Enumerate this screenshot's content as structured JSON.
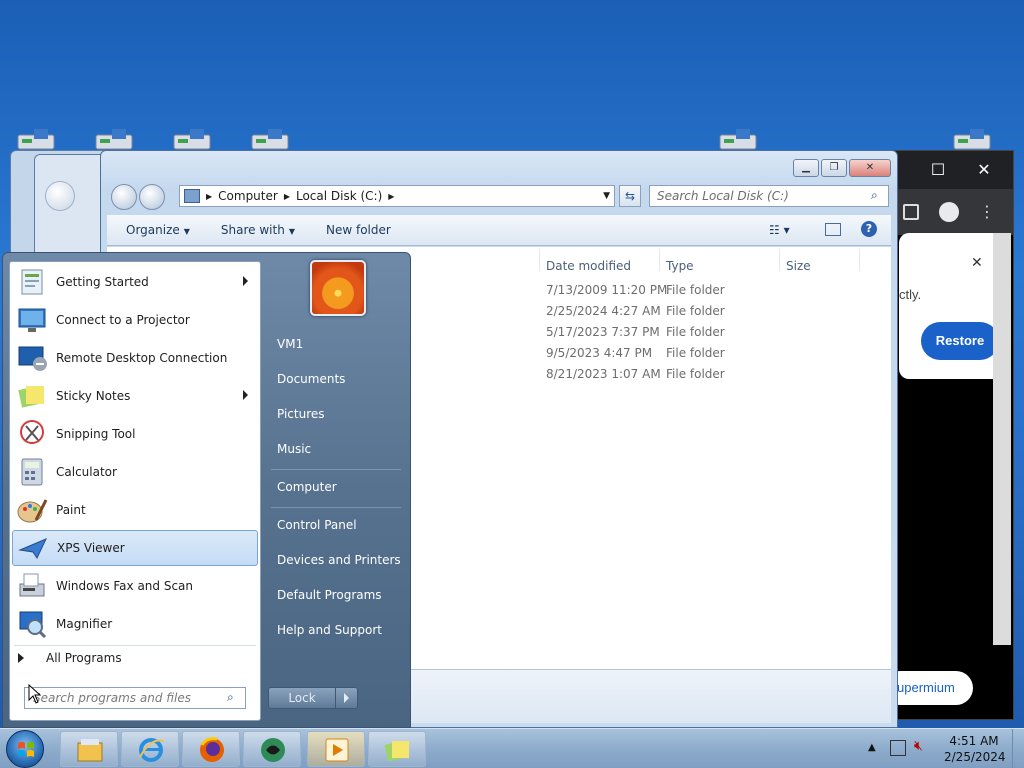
{
  "explorer": {
    "address": {
      "crumbs": [
        "Computer",
        "Local Disk (C:)"
      ]
    },
    "search_placeholder": "Search Local Disk (C:)",
    "toolbar": {
      "organize": "Organize",
      "share_with": "Share with",
      "new_folder": "New folder"
    },
    "columns": {
      "date_modified": "Date modified",
      "type": "Type",
      "size": "Size"
    },
    "rows": [
      {
        "date": "7/13/2009 11:20 PM",
        "type": "File folder"
      },
      {
        "date": "2/25/2024 4:27 AM",
        "type": "File folder"
      },
      {
        "date": "5/17/2023 7:37 PM",
        "type": "File folder"
      },
      {
        "date": "9/5/2023 4:47 PM",
        "type": "File folder"
      },
      {
        "date": "8/21/2023 1:07 AM",
        "type": "File folder"
      }
    ]
  },
  "chrome": {
    "popup_text": "ctly.",
    "restore_label": "Restore",
    "bottom_pill": "upermium"
  },
  "start_menu": {
    "programs": [
      {
        "label": "Getting Started",
        "icon": "getting-started-icon",
        "has_submenu": true
      },
      {
        "label": "Connect to a Projector",
        "icon": "projector-icon",
        "has_submenu": false
      },
      {
        "label": "Remote Desktop Connection",
        "icon": "remote-desktop-icon",
        "has_submenu": false
      },
      {
        "label": "Sticky Notes",
        "icon": "sticky-notes-icon",
        "has_submenu": true
      },
      {
        "label": "Snipping Tool",
        "icon": "snipping-tool-icon",
        "has_submenu": false
      },
      {
        "label": "Calculator",
        "icon": "calculator-icon",
        "has_submenu": false
      },
      {
        "label": "Paint",
        "icon": "paint-icon",
        "has_submenu": false
      },
      {
        "label": "XPS Viewer",
        "icon": "xps-viewer-icon",
        "has_submenu": false
      },
      {
        "label": "Windows Fax and Scan",
        "icon": "fax-scan-icon",
        "has_submenu": false
      },
      {
        "label": "Magnifier",
        "icon": "magnifier-icon",
        "has_submenu": false
      }
    ],
    "all_programs": "All Programs",
    "search_placeholder": "Search programs and files",
    "right_items": {
      "user": "VM1",
      "documents": "Documents",
      "pictures": "Pictures",
      "music": "Music",
      "computer": "Computer",
      "control_panel": "Control Panel",
      "devices_printers": "Devices and Printers",
      "default_programs": "Default Programs",
      "help_support": "Help and Support"
    },
    "lock_label": "Lock"
  },
  "taskbar": {
    "pinned": [
      "windows-explorer-icon",
      "internet-explorer-icon",
      "firefox-icon",
      "app-icon",
      "media-player-icon",
      "sticky-notes-icon"
    ],
    "clock_time": "4:51 AM",
    "clock_date": "2/25/2024"
  },
  "colors": {
    "accent": "#1a62c9",
    "desktop": "#2a78d2",
    "highlight": "#c5dcf6"
  }
}
